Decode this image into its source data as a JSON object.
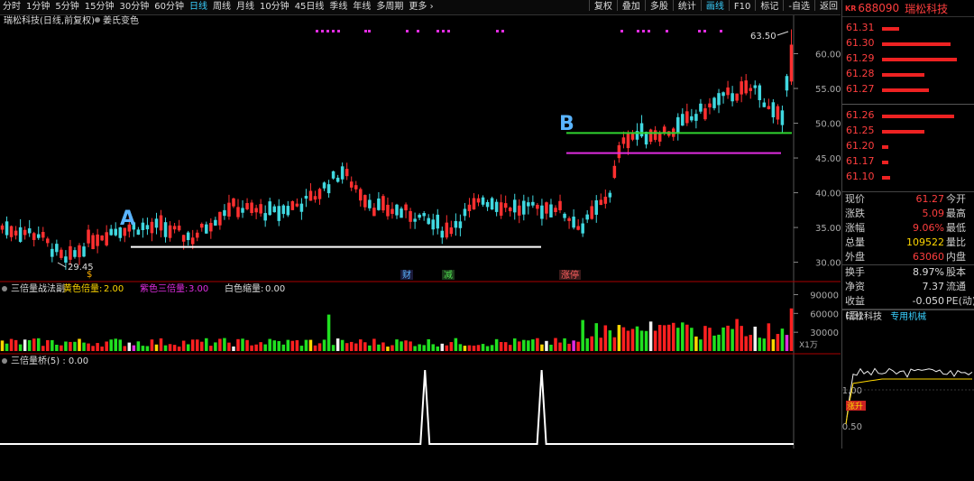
{
  "toolbar": {
    "periods": [
      "分时",
      "1分钟",
      "5分钟",
      "15分钟",
      "30分钟",
      "60分钟",
      "日线",
      "周线",
      "月线",
      "10分钟",
      "45日线",
      "季线",
      "年线",
      "多周期",
      "更多 ›"
    ],
    "active_period": "日线",
    "right_buttons": [
      "复权",
      "叠加",
      "多股",
      "统计",
      "画线",
      "F10",
      "标记",
      "-自选",
      "返回"
    ],
    "active_right": "画线"
  },
  "main": {
    "title": "瑞松科技(日线,前复权)",
    "indicator_label": "姜氏变色",
    "price_axis": [
      "60.00",
      "55.00",
      "50.00",
      "45.00",
      "40.00",
      "35.00",
      "30.00"
    ],
    "high_label": "63.50",
    "low_label": "29.45",
    "annotations": {
      "a": "A",
      "b": "B"
    },
    "event_markers": [
      "$",
      "财",
      "减",
      "涨停"
    ]
  },
  "volume_panel": {
    "title": "三倍量战法副",
    "yellow_label": "黄色倍量:",
    "yellow_value": "2.00",
    "purple_label": "紫色三倍量:",
    "purple_value": "3.00",
    "white_label": "白色缩量:",
    "white_value": "0.00",
    "axis": [
      "90000",
      "60000",
      "30000"
    ],
    "unit": "X1万"
  },
  "bridge_panel": {
    "title": "三倍量桥(5) : 0.00"
  },
  "side": {
    "kr_badge": "KR",
    "code": "688090",
    "name": "瑞松科技",
    "asks": [
      {
        "price": "61.31",
        "bar": 0.22
      },
      {
        "price": "61.30",
        "bar": 0.88
      },
      {
        "price": "61.29",
        "bar": 0.97
      },
      {
        "price": "61.28",
        "bar": 0.55
      },
      {
        "price": "61.27",
        "bar": 0.6
      }
    ],
    "bids": [
      {
        "price": "61.26",
        "bar": 0.93
      },
      {
        "price": "61.25",
        "bar": 0.55
      },
      {
        "price": "61.20",
        "bar": 0.08
      },
      {
        "price": "61.17",
        "bar": 0.08
      },
      {
        "price": "61.10",
        "bar": 0.1
      }
    ],
    "stats": [
      [
        {
          "label": "现价",
          "value": "61.27",
          "cls": "red"
        },
        {
          "label": "今开"
        }
      ],
      [
        {
          "label": "涨跌",
          "value": "5.09",
          "cls": "red"
        },
        {
          "label": "最高"
        }
      ],
      [
        {
          "label": "涨幅",
          "value": "9.06%",
          "cls": "red"
        },
        {
          "label": "最低"
        }
      ],
      [
        {
          "label": "总量",
          "value": "109522",
          "cls": "yel"
        },
        {
          "label": "量比"
        }
      ],
      [
        {
          "label": "外盘",
          "value": "63060",
          "cls": "red"
        },
        {
          "label": "内盘"
        }
      ]
    ],
    "stats2": [
      [
        {
          "label": "换手",
          "value": "8.97%",
          "cls": "wht"
        },
        {
          "label": "股本"
        }
      ],
      [
        {
          "label": "净资",
          "value": "7.37",
          "cls": "wht"
        },
        {
          "label": "流通"
        }
      ],
      [
        {
          "label": "收益(三)",
          "value": "-0.050",
          "cls": "wht"
        },
        {
          "label": "PE(动)"
        }
      ]
    ],
    "mini_name": "瑞松科技",
    "mini_category": "专用机械",
    "mini_axis": [
      "1.00",
      "0.50"
    ],
    "mini_badge": "涨升"
  },
  "chart_data": {
    "type": "candlestick",
    "ylim": [
      28,
      65
    ],
    "support_line_white": 32.2,
    "support_line_green": 48.6,
    "support_line_magenta": 45.7,
    "bridge_spikes_at_fraction": [
      0.51,
      0.65
    ]
  }
}
